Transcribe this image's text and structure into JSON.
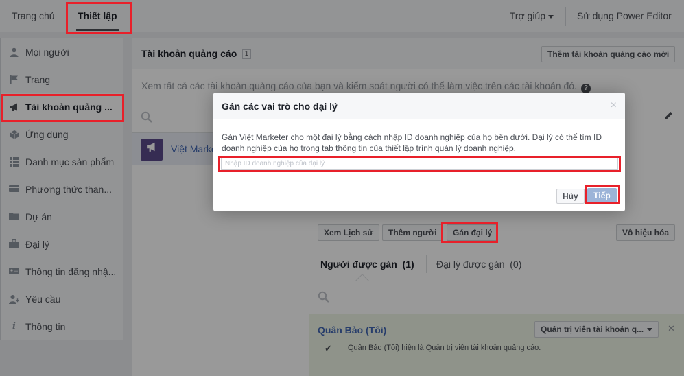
{
  "topnav": {
    "home": "Trang chủ",
    "settings": "Thiết lập",
    "help": "Trợ giúp",
    "power_editor": "Sử dụng Power Editor"
  },
  "sidebar": {
    "items": [
      {
        "label": "Mọi người",
        "icon": "person-icon"
      },
      {
        "label": "Trang",
        "icon": "flag-icon"
      },
      {
        "label": "Tài khoản quảng ...",
        "icon": "megaphone-icon"
      },
      {
        "label": "Ứng dụng",
        "icon": "cube-icon"
      },
      {
        "label": "Danh mục sản phẩm",
        "icon": "grid-icon"
      },
      {
        "label": "Phương thức than...",
        "icon": "card-icon"
      },
      {
        "label": "Dự án",
        "icon": "folder-icon"
      },
      {
        "label": "Đại lý",
        "icon": "briefcase-icon"
      },
      {
        "label": "Thông tin đăng nhậ...",
        "icon": "id-card-icon"
      },
      {
        "label": "Yêu cầu",
        "icon": "person-add-icon"
      },
      {
        "label": "Thông tin",
        "icon": "info-icon"
      }
    ]
  },
  "main": {
    "title": "Tài khoản quảng cáo",
    "count": "1",
    "add_account": "Thêm tài khoản quảng cáo mới",
    "description": "Xem tất cả các tài khoản quảng cáo của bạn và kiểm soát người có thể làm việc trên các tài khoản đó.",
    "account_name": "Việt Marke"
  },
  "actions": {
    "history": "Xem Lịch sử",
    "add_people": "Thêm người",
    "assign_agency": "Gán đại lý",
    "disable": "Vô hiệu hóa"
  },
  "tabs": {
    "assigned": "Người được gán",
    "assigned_count": "(1)",
    "agency": "Đại lý được gán",
    "agency_count": "(0)"
  },
  "assigned_person": {
    "name": "Quân Bảo (Tôi)",
    "role": "Quản trị viên tài khoản q...",
    "desc": "Quân Bảo (Tôi) hiện là Quản trị viên tài khoản quảng cáo."
  },
  "dialog": {
    "title": "Gán các vai trò cho đại lý",
    "close": "×",
    "text": "Gán Việt Marketer cho một đại lý bằng cách nhập ID doanh nghiệp của họ bên dưới. Đại lý có thể tìm ID doanh nghiệp của họ trong tab thông tin của thiết lập trình quản lý doanh nghiệp.",
    "input_placeholder": "Nhập ID doanh nghiệp của đại lý",
    "cancel": "Hủy",
    "next": "Tiếp"
  },
  "colors": {
    "highlight": "#e8202a",
    "link": "#4267b2",
    "next_button": "#9cb4d8",
    "assigned_bg": "#eff6e6"
  }
}
